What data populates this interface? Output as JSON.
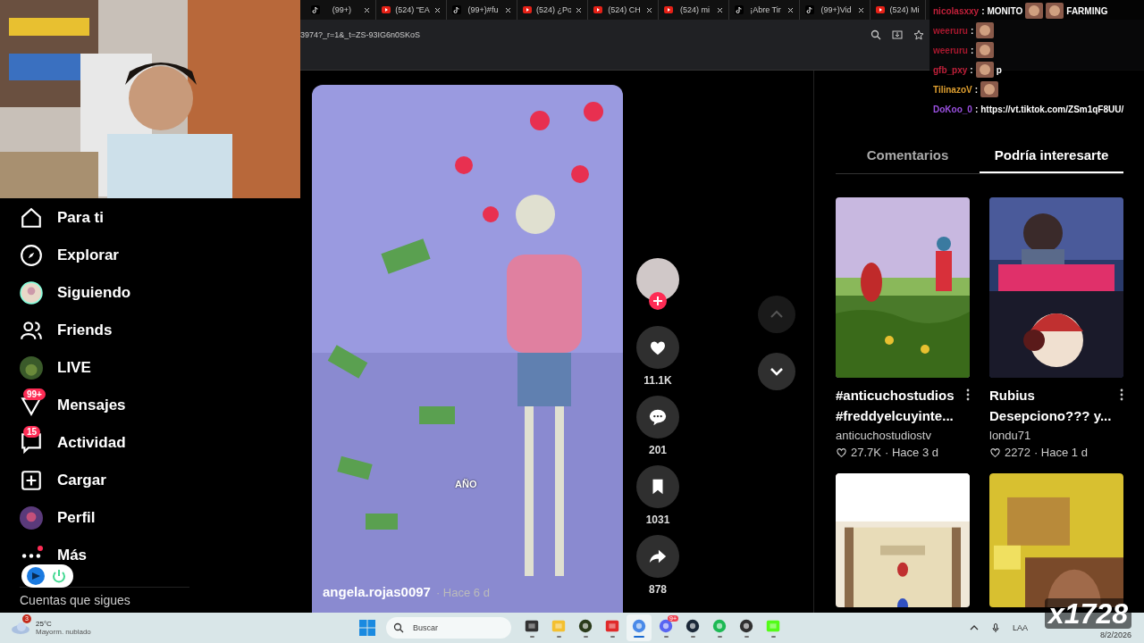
{
  "browser": {
    "tabs": [
      {
        "kind": "tiktok",
        "title": "(99+)"
      },
      {
        "kind": "youtube",
        "title": "(524) \"EA"
      },
      {
        "kind": "tiktok",
        "title": "(99+)#fu"
      },
      {
        "kind": "youtube",
        "title": "(524) ¿Po"
      },
      {
        "kind": "youtube",
        "title": "(524) CH"
      },
      {
        "kind": "youtube",
        "title": "(524) mi"
      },
      {
        "kind": "tiktok",
        "title": "¡Abre Tir"
      },
      {
        "kind": "tiktok",
        "title": "(99+)Vid"
      },
      {
        "kind": "youtube",
        "title": "(524) Mi",
        "close": false
      }
    ],
    "address": "3974?_r=1&_t=ZS-93IG6n0SKoS"
  },
  "sidebar": {
    "items": [
      {
        "kind": "home",
        "label": "Para ti"
      },
      {
        "kind": "compass",
        "label": "Explorar"
      },
      {
        "kind": "avatar",
        "label": "Siguiendo"
      },
      {
        "kind": "people",
        "label": "Friends"
      },
      {
        "kind": "live",
        "label": "LIVE"
      },
      {
        "kind": "message",
        "label": "Mensajes",
        "badge": "99+"
      },
      {
        "kind": "activity",
        "label": "Actividad",
        "badge": "15"
      },
      {
        "kind": "upload",
        "label": "Cargar"
      },
      {
        "kind": "profile",
        "label": "Perfil"
      },
      {
        "kind": "more",
        "label": "Más",
        "dot": true
      }
    ],
    "section": "Cuentas que sigues"
  },
  "video": {
    "kind": "picture",
    "caption": "AÑO",
    "author": "angela.rojas0097",
    "time": "· Hace 6 d",
    "actions": [
      {
        "kind": "like",
        "count": "11.1K"
      },
      {
        "kind": "comment",
        "count": "201"
      },
      {
        "kind": "save",
        "count": "1031"
      },
      {
        "kind": "share",
        "count": "878"
      }
    ]
  },
  "panel": {
    "tabs": [
      {
        "label": "Comentarios",
        "selected": false
      },
      {
        "label": "Podría interesarte",
        "selected": true
      }
    ],
    "cards": [
      {
        "kind": "field",
        "title": [
          "#anticuchostudios",
          "#freddyelcuyinte..."
        ],
        "author": "anticuchostudiostv",
        "likes": "27.7K",
        "time": "· Hace 3 d"
      },
      {
        "kind": "streamer",
        "title": [
          "Rubius",
          "Desepciono??? y..."
        ],
        "author": "londu71",
        "likes": "2272",
        "time": "· Hace 1 d"
      },
      {
        "kind": "game"
      },
      {
        "kind": "meme"
      }
    ]
  },
  "chat": [
    {
      "user": "nicolasxxy",
      "sep": ":",
      "color": "#c0203a",
      "parts": [
        {
          "kind": "text",
          "text": "MONITO"
        },
        {
          "kind": "emote"
        },
        {
          "kind": "emote"
        },
        {
          "kind": "text",
          "text": "FARMING"
        }
      ]
    },
    {
      "user": "weeruru",
      "sep": ":",
      "color": "#a8182e",
      "parts": [
        {
          "kind": "emote"
        }
      ]
    },
    {
      "user": "weeruru",
      "sep": ":",
      "color": "#a8182e",
      "parts": [
        {
          "kind": "emote"
        }
      ]
    },
    {
      "user": "gfb_pxy",
      "sep": ":",
      "color": "#c0203a",
      "parts": [
        {
          "kind": "emote"
        },
        {
          "kind": "text",
          "text": "p"
        }
      ]
    },
    {
      "user": "TilinazoV",
      "sep": ":",
      "color": "#e0a030",
      "parts": [
        {
          "kind": "emote"
        }
      ]
    },
    {
      "user": "DoKoo_0",
      "sep": ":",
      "color": "#9a50e0",
      "parts": [
        {
          "kind": "text",
          "text": "https://vt.tiktok.com/ZSm1qF8UU/"
        }
      ]
    }
  ],
  "taskbar": {
    "weather": {
      "temp": "25°C",
      "desc": "Mayorm. nublado",
      "badge": "3"
    },
    "search": {
      "placeholder": "Buscar"
    },
    "apps": [
      {
        "kind": "taskview",
        "selected": false
      },
      {
        "kind": "folder",
        "selected": false
      },
      {
        "kind": "app",
        "selected": false
      },
      {
        "kind": "remote",
        "selected": false
      },
      {
        "kind": "browser",
        "selected": true
      },
      {
        "kind": "chat",
        "selected": false,
        "badge": "9+"
      },
      {
        "kind": "steam",
        "selected": false
      },
      {
        "kind": "music",
        "selected": false
      },
      {
        "kind": "recorder",
        "selected": false
      },
      {
        "kind": "stream",
        "selected": false
      }
    ],
    "lang": "LAA",
    "date": "8/2/2026"
  },
  "overlay": {
    "counter": "x1728"
  }
}
